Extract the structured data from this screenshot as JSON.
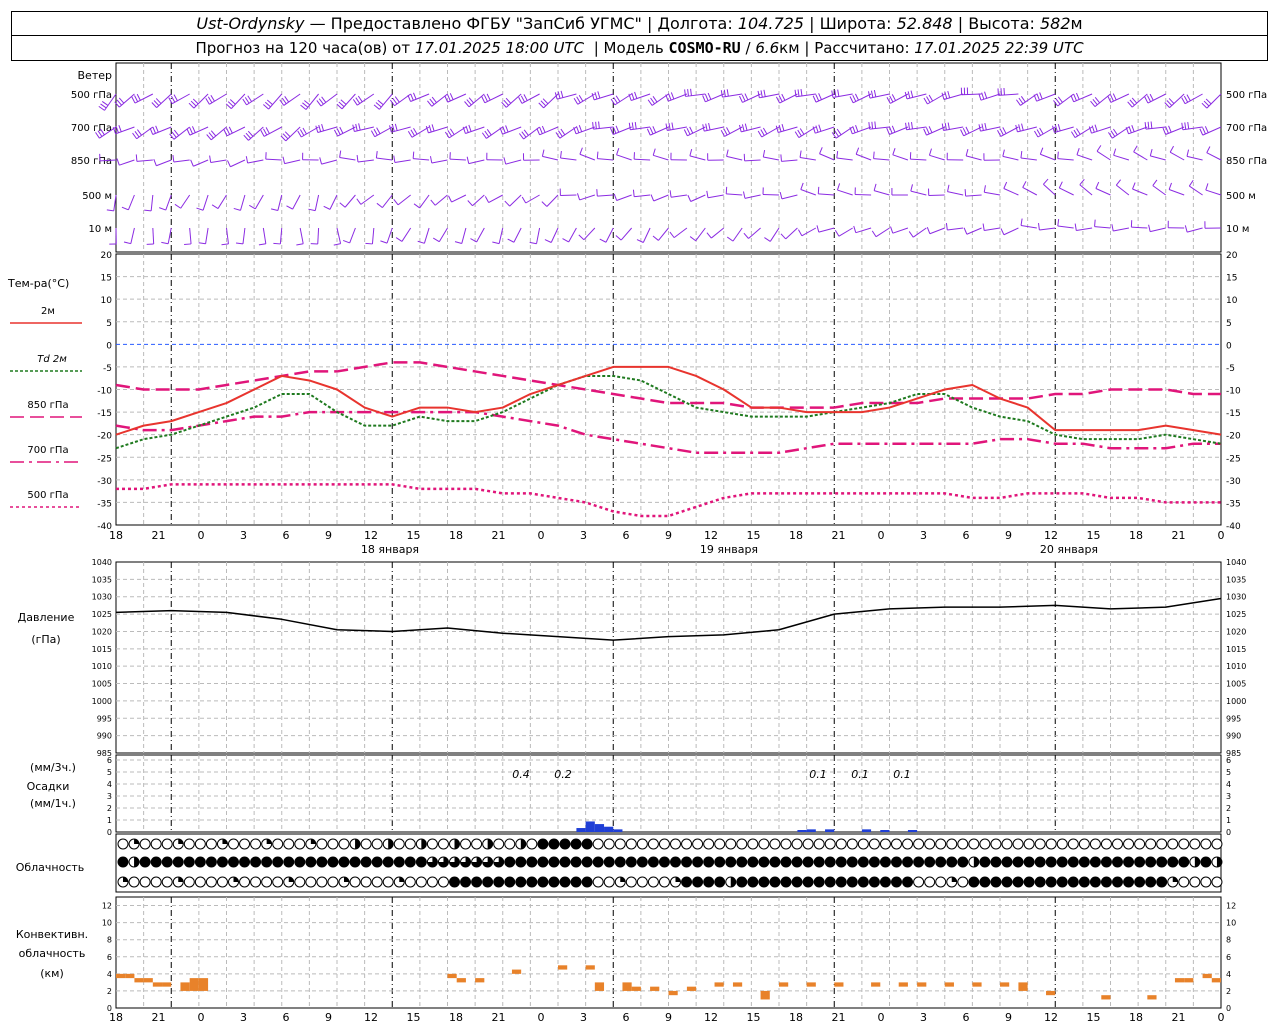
{
  "header": {
    "station": "Ust-Ordynsky",
    "dash": "—",
    "provider": "Предоставлено ФГБУ \"ЗапСиб УГМС\"",
    "lon_label": "Долгота:",
    "lon_value": "104.725",
    "lat_label": "Широта:",
    "lat_value": "52.848",
    "alt_label": "Высота:",
    "alt_value": "582",
    "alt_unit": "м",
    "forecast_text": "Прогноз на 120 часа(ов) от",
    "forecast_start": "17.01.2025 18:00 UTC",
    "model_label": "Модель",
    "model_name": "COSMO-RU",
    "model_res": "6.6",
    "model_res_unit": "км",
    "calc_label": "Рассчитано:",
    "calc_time": "17.01.2025 22:39 UTC",
    "sep": "|"
  },
  "time_axis": {
    "hour_labels": [
      "18",
      "21",
      "0",
      "3",
      "6",
      "9",
      "12",
      "15",
      "18",
      "21",
      "0",
      "3",
      "6",
      "9",
      "12",
      "15",
      "18",
      "21",
      "0",
      "3",
      "6",
      "9",
      "12",
      "15",
      "18",
      "21",
      "0"
    ],
    "day_labels": [
      "18 января",
      "19 января",
      "20 января"
    ]
  },
  "wind_panel": {
    "title": "Ветер",
    "levels": [
      "500 гПа",
      "700 гПа",
      "850 гПа",
      "500 м",
      "10 м"
    ],
    "barb_color": "#8b2be2"
  },
  "temp_panel": {
    "title": "Тем-ра(°C)",
    "ticks": [
      "20",
      "15",
      "10",
      "5",
      "0",
      "-5",
      "-10",
      "-15",
      "-20",
      "-25",
      "-30",
      "-35",
      "-40"
    ],
    "legend": [
      {
        "label": "2м",
        "color": "#e8342e"
      },
      {
        "label": "Td 2м",
        "color": "#1f7a1f"
      },
      {
        "label": "850 гПа",
        "color": "#e0157a"
      },
      {
        "label": "700 гПа",
        "color": "#e0157a"
      },
      {
        "label": "500 гПа",
        "color": "#e0157a"
      }
    ]
  },
  "pressure_panel": {
    "title": "Давление",
    "unit": "(гПа)",
    "ticks": [
      "1040",
      "1035",
      "1030",
      "1025",
      "1020",
      "1015",
      "1010",
      "1005",
      "1000",
      "995",
      "990",
      "985"
    ]
  },
  "precip_panel": {
    "title_unit1": "(мм/3ч.)",
    "title": "Осадки",
    "title_unit2": "(мм/1ч.)",
    "ticks": [
      "6",
      "5",
      "4",
      "3",
      "2",
      "1",
      "0"
    ],
    "annotations": [
      "0.4",
      "0.2",
      "0.1",
      "0.1",
      "0.1"
    ]
  },
  "cloud_panel": {
    "title": "Облачность"
  },
  "conv_panel": {
    "title_line1": "Конвективн.",
    "title_line2": "облачность",
    "unit": "(км)",
    "ticks": [
      "12",
      "10",
      "8",
      "6",
      "4",
      "2",
      "0"
    ]
  },
  "chart_data": [
    {
      "type": "line",
      "title": "Тем-ра(°C)",
      "ylim": [
        -40,
        20
      ],
      "x_hours": [
        0,
        3,
        6,
        9,
        12,
        15,
        18,
        21,
        24,
        27,
        30,
        33,
        36,
        39,
        42,
        45,
        48,
        51,
        54,
        57,
        60,
        63,
        66,
        69,
        72,
        75,
        78,
        81,
        84,
        87,
        90,
        93,
        96,
        99,
        102,
        105,
        108,
        111,
        114,
        117,
        120
      ],
      "series": [
        {
          "name": "2м",
          "values": [
            -20,
            -18,
            -17,
            -15,
            -13,
            -10,
            -7,
            -8,
            -10,
            -14,
            -16,
            -14,
            -14,
            -15,
            -14,
            -11,
            -9,
            -7,
            -5,
            -5,
            -5,
            -7,
            -10,
            -14,
            -14,
            -15,
            -15,
            -15,
            -14,
            -12,
            -10,
            -9,
            -12,
            -14,
            -19,
            -19,
            -19,
            -19,
            -18,
            -19,
            -20
          ]
        },
        {
          "name": "Td 2м",
          "values": [
            -23,
            -21,
            -20,
            -18,
            -16,
            -14,
            -11,
            -11,
            -15,
            -18,
            -18,
            -16,
            -17,
            -17,
            -15,
            -12,
            -9,
            -7,
            -7,
            -8,
            -11,
            -14,
            -15,
            -16,
            -16,
            -16,
            -15,
            -14,
            -13,
            -11,
            -11,
            -14,
            -16,
            -17,
            -20,
            -21,
            -21,
            -21,
            -20,
            -21,
            -22
          ]
        },
        {
          "name": "850 гПа",
          "values": [
            -9,
            -10,
            -10,
            -10,
            -9,
            -8,
            -7,
            -6,
            -6,
            -5,
            -4,
            -4,
            -5,
            -6,
            -7,
            -8,
            -9,
            -10,
            -11,
            -12,
            -13,
            -13,
            -13,
            -14,
            -14,
            -14,
            -14,
            -13,
            -13,
            -13,
            -12,
            -12,
            -12,
            -12,
            -11,
            -11,
            -10,
            -10,
            -10,
            -11,
            -11
          ]
        },
        {
          "name": "700 гПа",
          "values": [
            -18,
            -19,
            -19,
            -18,
            -17,
            -16,
            -16,
            -15,
            -15,
            -15,
            -15,
            -15,
            -15,
            -15,
            -16,
            -17,
            -18,
            -20,
            -21,
            -22,
            -23,
            -24,
            -24,
            -24,
            -24,
            -23,
            -22,
            -22,
            -22,
            -22,
            -22,
            -22,
            -21,
            -21,
            -22,
            -22,
            -23,
            -23,
            -23,
            -22,
            -22
          ]
        },
        {
          "name": "500 гПа",
          "values": [
            -32,
            -32,
            -31,
            -31,
            -31,
            -31,
            -31,
            -31,
            -31,
            -31,
            -31,
            -32,
            -32,
            -32,
            -33,
            -33,
            -34,
            -35,
            -37,
            -38,
            -38,
            -36,
            -34,
            -33,
            -33,
            -33,
            -33,
            -33,
            -33,
            -33,
            -33,
            -34,
            -34,
            -33,
            -33,
            -33,
            -34,
            -34,
            -35,
            -35,
            -35
          ]
        }
      ]
    },
    {
      "type": "line",
      "title": "Давление",
      "ylim": [
        985,
        1040
      ],
      "x_hours": [
        0,
        6,
        12,
        18,
        24,
        30,
        36,
        42,
        48,
        54,
        60,
        66,
        72,
        78,
        84,
        90,
        96,
        102,
        108,
        114,
        120
      ],
      "series": [
        {
          "name": "",
          "values": [
            1025.5,
            1026,
            1025.5,
            1023.5,
            1020.5,
            1020,
            1021,
            1019.5,
            1018.5,
            1017.5,
            1018.5,
            1019,
            1020.5,
            1025,
            1026.5,
            1027,
            1027,
            1027.5,
            1026.5,
            1027,
            1029.5
          ]
        }
      ]
    },
    {
      "type": "bar",
      "title": "Осадки",
      "ylim": [
        0,
        6
      ],
      "bars": [
        {
          "hour": 51,
          "value": 0.15
        },
        {
          "hour": 52,
          "value": 0.4
        },
        {
          "hour": 53,
          "value": 0.3
        },
        {
          "hour": 54,
          "value": 0.2
        },
        {
          "hour": 55,
          "value": 0.1
        },
        {
          "hour": 75,
          "value": 0.05
        },
        {
          "hour": 76,
          "value": 0.1
        },
        {
          "hour": 78,
          "value": 0.1
        },
        {
          "hour": 82,
          "value": 0.1
        },
        {
          "hour": 84,
          "value": 0.05
        },
        {
          "hour": 87,
          "value": 0.05
        }
      ]
    },
    {
      "type": "bar",
      "title": "Конвективная облачность",
      "ylim": [
        0,
        13
      ],
      "bars": [
        {
          "hour": 1,
          "bottom": 3.5,
          "top": 4
        },
        {
          "hour": 2,
          "bottom": 3.5,
          "top": 4
        },
        {
          "hour": 3,
          "bottom": 3,
          "top": 3.5
        },
        {
          "hour": 4,
          "bottom": 3,
          "top": 3.5
        },
        {
          "hour": 5,
          "bottom": 2.5,
          "top": 3
        },
        {
          "hour": 6,
          "bottom": 2.5,
          "top": 3
        },
        {
          "hour": 8,
          "bottom": 2,
          "top": 3
        },
        {
          "hour": 9,
          "bottom": 2,
          "top": 3.5
        },
        {
          "hour": 10,
          "bottom": 2,
          "top": 3.5
        },
        {
          "hour": 37,
          "bottom": 3.5,
          "top": 4
        },
        {
          "hour": 38,
          "bottom": 3,
          "top": 3.5
        },
        {
          "hour": 40,
          "bottom": 3,
          "top": 3.5
        },
        {
          "hour": 44,
          "bottom": 4,
          "top": 4.5
        },
        {
          "hour": 49,
          "bottom": 4.5,
          "top": 5
        },
        {
          "hour": 52,
          "bottom": 4.5,
          "top": 5
        },
        {
          "hour": 53,
          "bottom": 2,
          "top": 3
        },
        {
          "hour": 56,
          "bottom": 2,
          "top": 3
        },
        {
          "hour": 57,
          "bottom": 2,
          "top": 2.5
        },
        {
          "hour": 59,
          "bottom": 2,
          "top": 2.5
        },
        {
          "hour": 61,
          "bottom": 1.5,
          "top": 2
        },
        {
          "hour": 63,
          "bottom": 2,
          "top": 2.5
        },
        {
          "hour": 66,
          "bottom": 2.5,
          "top": 3
        },
        {
          "hour": 68,
          "bottom": 2.5,
          "top": 3
        },
        {
          "hour": 71,
          "bottom": 1,
          "top": 2
        },
        {
          "hour": 73,
          "bottom": 2.5,
          "top": 3
        },
        {
          "hour": 76,
          "bottom": 2.5,
          "top": 3
        },
        {
          "hour": 79,
          "bottom": 2.5,
          "top": 3
        },
        {
          "hour": 83,
          "bottom": 2.5,
          "top": 3
        },
        {
          "hour": 86,
          "bottom": 2.5,
          "top": 3
        },
        {
          "hour": 88,
          "bottom": 2.5,
          "top": 3
        },
        {
          "hour": 91,
          "bottom": 2.5,
          "top": 3
        },
        {
          "hour": 94,
          "bottom": 2.5,
          "top": 3
        },
        {
          "hour": 97,
          "bottom": 2.5,
          "top": 3
        },
        {
          "hour": 99,
          "bottom": 2,
          "top": 3
        },
        {
          "hour": 102,
          "bottom": 1.5,
          "top": 2
        },
        {
          "hour": 108,
          "bottom": 1,
          "top": 1.5
        },
        {
          "hour": 113,
          "bottom": 1,
          "top": 1.5
        },
        {
          "hour": 116,
          "bottom": 3,
          "top": 3.5
        },
        {
          "hour": 117,
          "bottom": 3,
          "top": 3.5
        },
        {
          "hour": 119,
          "bottom": 3.5,
          "top": 4
        },
        {
          "hour": 120,
          "bottom": 3,
          "top": 3.5
        }
      ]
    }
  ]
}
